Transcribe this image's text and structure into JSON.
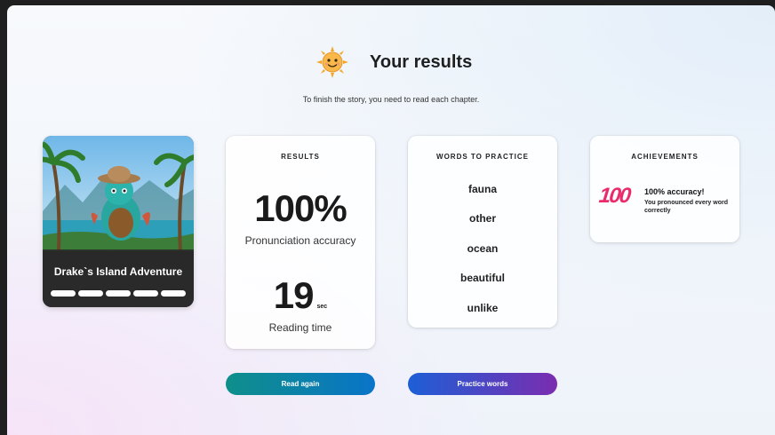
{
  "header": {
    "title": "Your results",
    "subtitle": "To finish the story, you need to read each chapter."
  },
  "story": {
    "title": "Drake`s Island Adventure",
    "chapters_total": 5,
    "chapters_read": 5
  },
  "results": {
    "heading": "RESULTS",
    "accuracy_value": "100%",
    "accuracy_label": "Pronunciation accuracy",
    "time_value": "19",
    "time_unit": "sec",
    "time_label": "Reading time"
  },
  "words": {
    "heading": "WORDS TO PRACTICE",
    "items": [
      "fauna",
      "other",
      "ocean",
      "beautiful",
      "unlike"
    ]
  },
  "achievements": {
    "heading": "ACHIEVEMENTS",
    "items": [
      {
        "icon_text": "100",
        "title": "100% accuracy!",
        "description": "You pronounced every word correctly"
      }
    ]
  },
  "actions": {
    "read_again": "Read again",
    "practice_words": "Practice words"
  },
  "colors": {
    "read_again_gradient": [
      "#0e8f8a",
      "#0a74c8"
    ],
    "practice_gradient": [
      "#1d5fd6",
      "#7a2db0"
    ],
    "achievement_icon": "#ea2c6b"
  }
}
